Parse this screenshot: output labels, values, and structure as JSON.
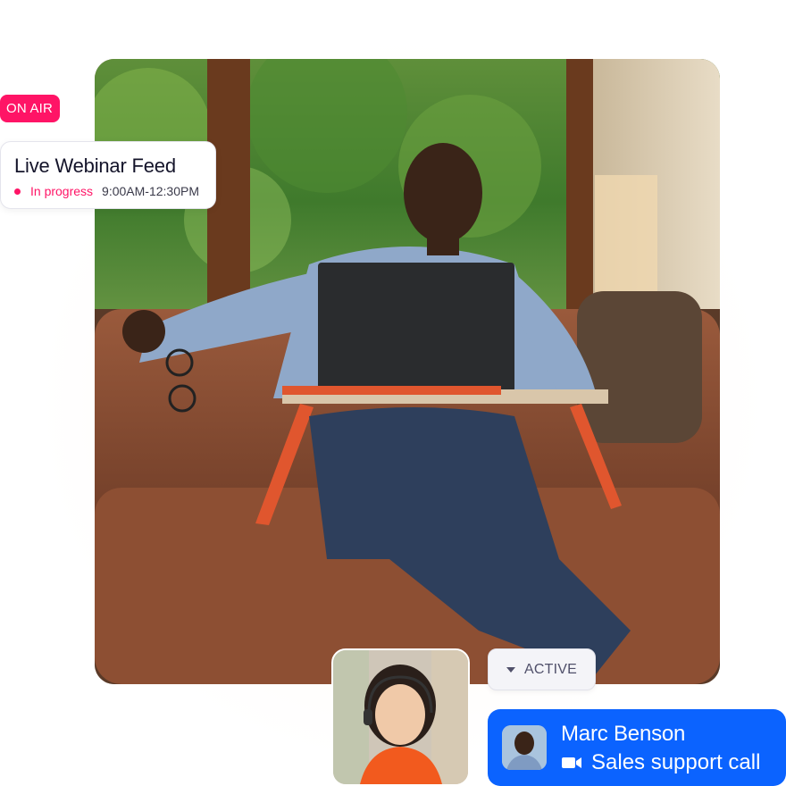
{
  "badge": {
    "label": "ON AIR",
    "color": "#ff1466"
  },
  "webinar": {
    "title": "Live Webinar Feed",
    "status": "In progress",
    "time": "9:00AM-12:30PM"
  },
  "participant": {
    "icon": "woman-headset-avatar"
  },
  "active_pill": {
    "label": "ACTIVE",
    "icon": "caret-down-icon"
  },
  "call": {
    "name": "Marc Benson",
    "subtitle": "Sales support call",
    "icon": "video-camera-icon",
    "color": "#0b63ff"
  },
  "photo": {
    "subject": "man-on-couch-with-laptop"
  }
}
